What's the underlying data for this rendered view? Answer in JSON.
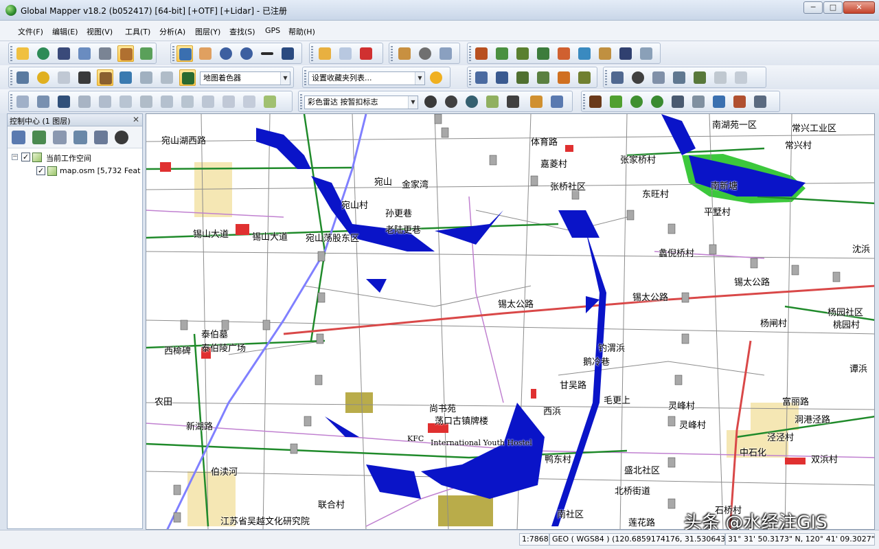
{
  "window": {
    "title": "Global Mapper v18.2 (b052417) [64-bit] [+OTF] [+Lidar] - 已注册",
    "minimize": "─",
    "maximize": "□",
    "close": "✕"
  },
  "menu": [
    "文件(F)",
    "编辑(E)",
    "视图(V)",
    "工具(T)",
    "分析(A)",
    "图层(Y)",
    "查找(S)",
    "GPS",
    "帮助(H)"
  ],
  "toolbar": {
    "shader_combo": "地图着色器",
    "bookmark_combo": "设置收藏夹列表...",
    "radar_combo": "彩色雷达 按暂扣标志"
  },
  "control_center": {
    "title": "控制中心 (1 图层)",
    "close": "✕",
    "workspace_label": "当前工作空间",
    "layer_label": "map.osm [5,732 Features]",
    "expander": "−",
    "check": "✓"
  },
  "map": {
    "labels": [
      "南湖苑一区",
      "常兴工业区",
      "常兴村",
      "宛山湖西路",
      "体育路",
      "嘉菱村",
      "张家桥村",
      "宛山",
      "金家湾",
      "张桥社区",
      "东旺村",
      "南新塘",
      "宛山村",
      "孙更巷",
      "平墅村",
      "锡山大道",
      "锡山大道",
      "宛山荡股东区",
      "老陆更巷",
      "沈浜",
      "蠡倪桥村",
      "锡太公路",
      "锡太公路",
      "锡太公路",
      "杨园社区",
      "杨闸村",
      "桃园村",
      "泰伯墓",
      "泰伯陵广场",
      "西椧碑",
      "钓渭浜",
      "鹅冷巷",
      "谭浜",
      "甘吴路",
      "毛更上",
      "富丽路",
      "尚书苑",
      "荡口古镇牌楼",
      "西浜",
      "灵峰村",
      "灵峰村",
      "洞港泾路",
      "泾泾村",
      "农田",
      "新湖路",
      "KFC",
      "International Youth Hostel",
      "中石化",
      "双浜村",
      "鸭东村",
      "盛北社区",
      "北桥街道",
      "石桥村",
      "联合村",
      "南社区",
      "莲花路",
      "江苏省吴越文化研究院",
      "伯渎河"
    ]
  },
  "status": {
    "scale": "1:78680",
    "projection": "GEO ( WGS84 ) (120.6859174176, 31.5306436877 )",
    "dms": "31° 31' 50.3173\" N, 120° 41' 09.3027\" E"
  },
  "watermark": "头条 @水经注GIS",
  "colors": {
    "water": "#0a14c8",
    "highway": "#d94848",
    "major_road": "#1f8a2a",
    "local_road": "#c080d0",
    "minor_road": "#8c8c8c",
    "park": "#3cc83c"
  }
}
